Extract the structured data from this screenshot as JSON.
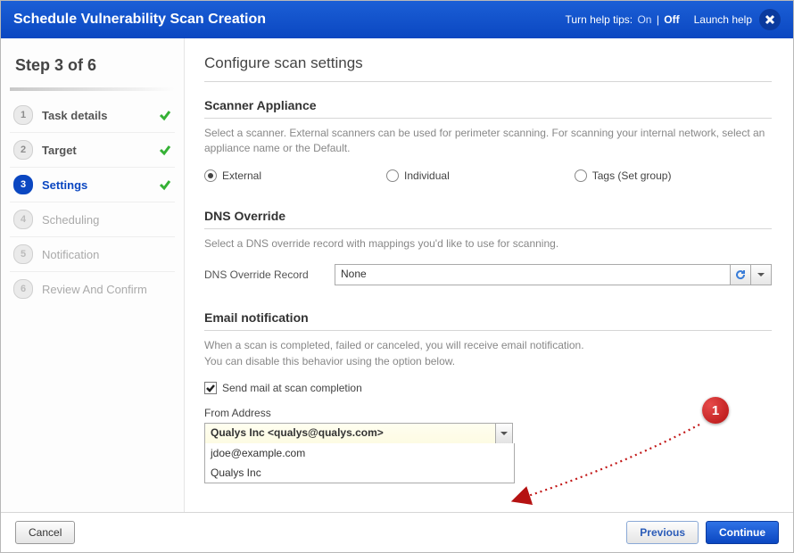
{
  "header": {
    "title": "Schedule Vulnerability Scan Creation",
    "help_tips_label": "Turn help tips:",
    "help_on": "On",
    "help_off": "Off",
    "launch_help": "Launch help"
  },
  "wizard": {
    "step_header": "Step 3 of 6",
    "steps": [
      {
        "num": "1",
        "label": "Task details",
        "state": "done"
      },
      {
        "num": "2",
        "label": "Target",
        "state": "done"
      },
      {
        "num": "3",
        "label": "Settings",
        "state": "current"
      },
      {
        "num": "4",
        "label": "Scheduling",
        "state": "future"
      },
      {
        "num": "5",
        "label": "Notification",
        "state": "future"
      },
      {
        "num": "6",
        "label": "Review And Confirm",
        "state": "future"
      }
    ]
  },
  "main": {
    "page_title": "Configure scan settings",
    "scanner": {
      "title": "Scanner Appliance",
      "desc": "Select a scanner. External scanners can be used for perimeter scanning. For scanning your internal network, select an appliance name or the Default.",
      "options": [
        "External",
        "Individual",
        "Tags (Set group)"
      ],
      "selected": "External"
    },
    "dns": {
      "title": "DNS Override",
      "desc": "Select a DNS override record with mappings you'd like to use for scanning.",
      "field_label": "DNS Override Record",
      "value": "None"
    },
    "email": {
      "title": "Email notification",
      "desc": "When a scan is completed, failed or canceled, you will receive email notification.\nYou can disable this behavior using the option below.",
      "checkbox_label": "Send mail at scan completion",
      "checkbox_checked": true,
      "from_label": "From Address",
      "from_value": "Qualys Inc <qualys@qualys.com>",
      "from_options": [
        "jdoe@example.com",
        "Qualys Inc"
      ]
    }
  },
  "annotation": {
    "badge": "1"
  },
  "footer": {
    "cancel": "Cancel",
    "previous": "Previous",
    "continue": "Continue"
  }
}
